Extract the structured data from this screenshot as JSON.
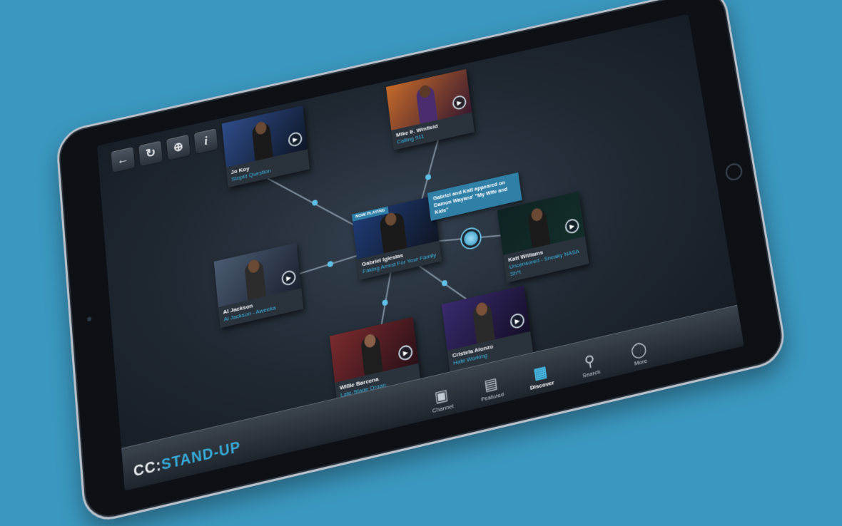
{
  "toolbar": {
    "back_icon": "back-arrow-icon",
    "refresh_icon": "refresh-icon",
    "recenter_icon": "crosshair-icon",
    "info_icon": "info-icon"
  },
  "now_playing": {
    "badge": "NOW PLAYING",
    "name": "Gabriel Iglesias",
    "show": "Faking Arrest For Your Family",
    "tooltip": "Gabriel and Katt appeared on Damon Wayans' \"My Wife and Kids\""
  },
  "nodes": [
    {
      "name": "Jo Koy",
      "show": "Stupid Question"
    },
    {
      "name": "Mike E. Winfield",
      "show": "Calling 911"
    },
    {
      "name": "Al Jackson",
      "show": "Al Jackson - Aweeka"
    },
    {
      "name": "Katt Williams",
      "show": "Uncensored - Sneaky NASA Sh*t"
    },
    {
      "name": "Willie Barcena",
      "show": "Late-Stage Organ Transplants"
    },
    {
      "name": "Cristela Alonzo",
      "show": "Hate Working"
    }
  ],
  "logo": {
    "prefix": "CC:",
    "title": "STAND-UP"
  },
  "tabs": [
    {
      "label": "Channel",
      "icon": "tv-icon"
    },
    {
      "label": "Featured",
      "icon": "featured-icon"
    },
    {
      "label": "Discover",
      "icon": "discover-icon"
    },
    {
      "label": "Search",
      "icon": "search-icon"
    },
    {
      "label": "More",
      "icon": "more-icon"
    }
  ],
  "active_tab": "Discover",
  "colors": {
    "accent": "#38abd9",
    "background": "#3a97bf"
  }
}
